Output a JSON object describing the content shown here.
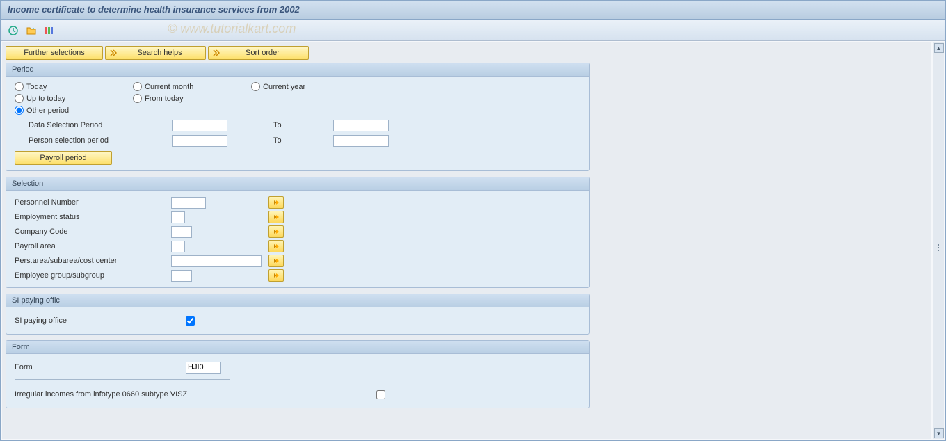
{
  "window": {
    "title": "Income certificate to determine health insurance services from 2002"
  },
  "watermark": "© www.tutorialkart.com",
  "action_buttons": {
    "further_selections": "Further selections",
    "search_helps": "Search helps",
    "sort_order": "Sort order"
  },
  "period": {
    "header": "Period",
    "radios": {
      "today": "Today",
      "current_month": "Current month",
      "current_year": "Current year",
      "up_to_today": "Up to today",
      "from_today": "From today",
      "other_period": "Other period"
    },
    "data_selection_label": "Data Selection Period",
    "person_selection_label": "Person selection period",
    "to_label": "To",
    "payroll_period_btn": "Payroll period",
    "values": {
      "data_from": "",
      "data_to": "",
      "person_from": "",
      "person_to": ""
    }
  },
  "selection": {
    "header": "Selection",
    "rows": [
      {
        "label": "Personnel Number",
        "width": "w50",
        "val": ""
      },
      {
        "label": "Employment status",
        "width": "w20",
        "val": ""
      },
      {
        "label": "Company Code",
        "width": "w30",
        "val": ""
      },
      {
        "label": "Payroll area",
        "width": "w20",
        "val": ""
      },
      {
        "label": "Pers.area/subarea/cost center",
        "width": "w120",
        "val": ""
      },
      {
        "label": "Employee group/subgroup",
        "width": "w30",
        "val": ""
      }
    ]
  },
  "si_paying": {
    "header": "SI paying offic",
    "label": "SI paying office",
    "checked": true
  },
  "form": {
    "header": "Form",
    "label": "Form",
    "value": "HJI0",
    "irregular_label": "Irregular incomes from infotype 0660 subtype VISZ",
    "irregular_checked": false
  }
}
